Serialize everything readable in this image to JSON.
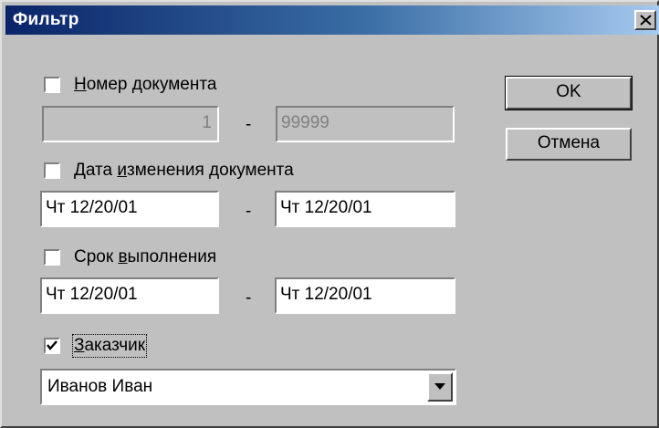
{
  "window": {
    "title": "Фильтр"
  },
  "buttons": {
    "ok": "OK",
    "cancel": "Отмена"
  },
  "doc_number": {
    "label_prefix": "",
    "label_mnemonic": "Н",
    "label_rest": "омер документа",
    "checked": false,
    "from": "1",
    "to": "99999"
  },
  "change_date": {
    "label_prefix": "Дата ",
    "label_mnemonic": "и",
    "label_rest": "зменения документа",
    "checked": false,
    "from": "Чт 12/20/01",
    "to": "Чт 12/20/01"
  },
  "deadline": {
    "label_prefix": "Срок ",
    "label_mnemonic": "в",
    "label_rest": "ыполнения",
    "checked": false,
    "from": "Чт 12/20/01",
    "to": "Чт 12/20/01"
  },
  "customer": {
    "label_prefix": "",
    "label_mnemonic": "З",
    "label_rest": "аказчик",
    "checked": true,
    "selected": "Иванов Иван"
  },
  "separator": "-",
  "icons": {
    "close": "close-icon",
    "check": "checkmark-icon",
    "dropdown": "chevron-down-icon"
  }
}
